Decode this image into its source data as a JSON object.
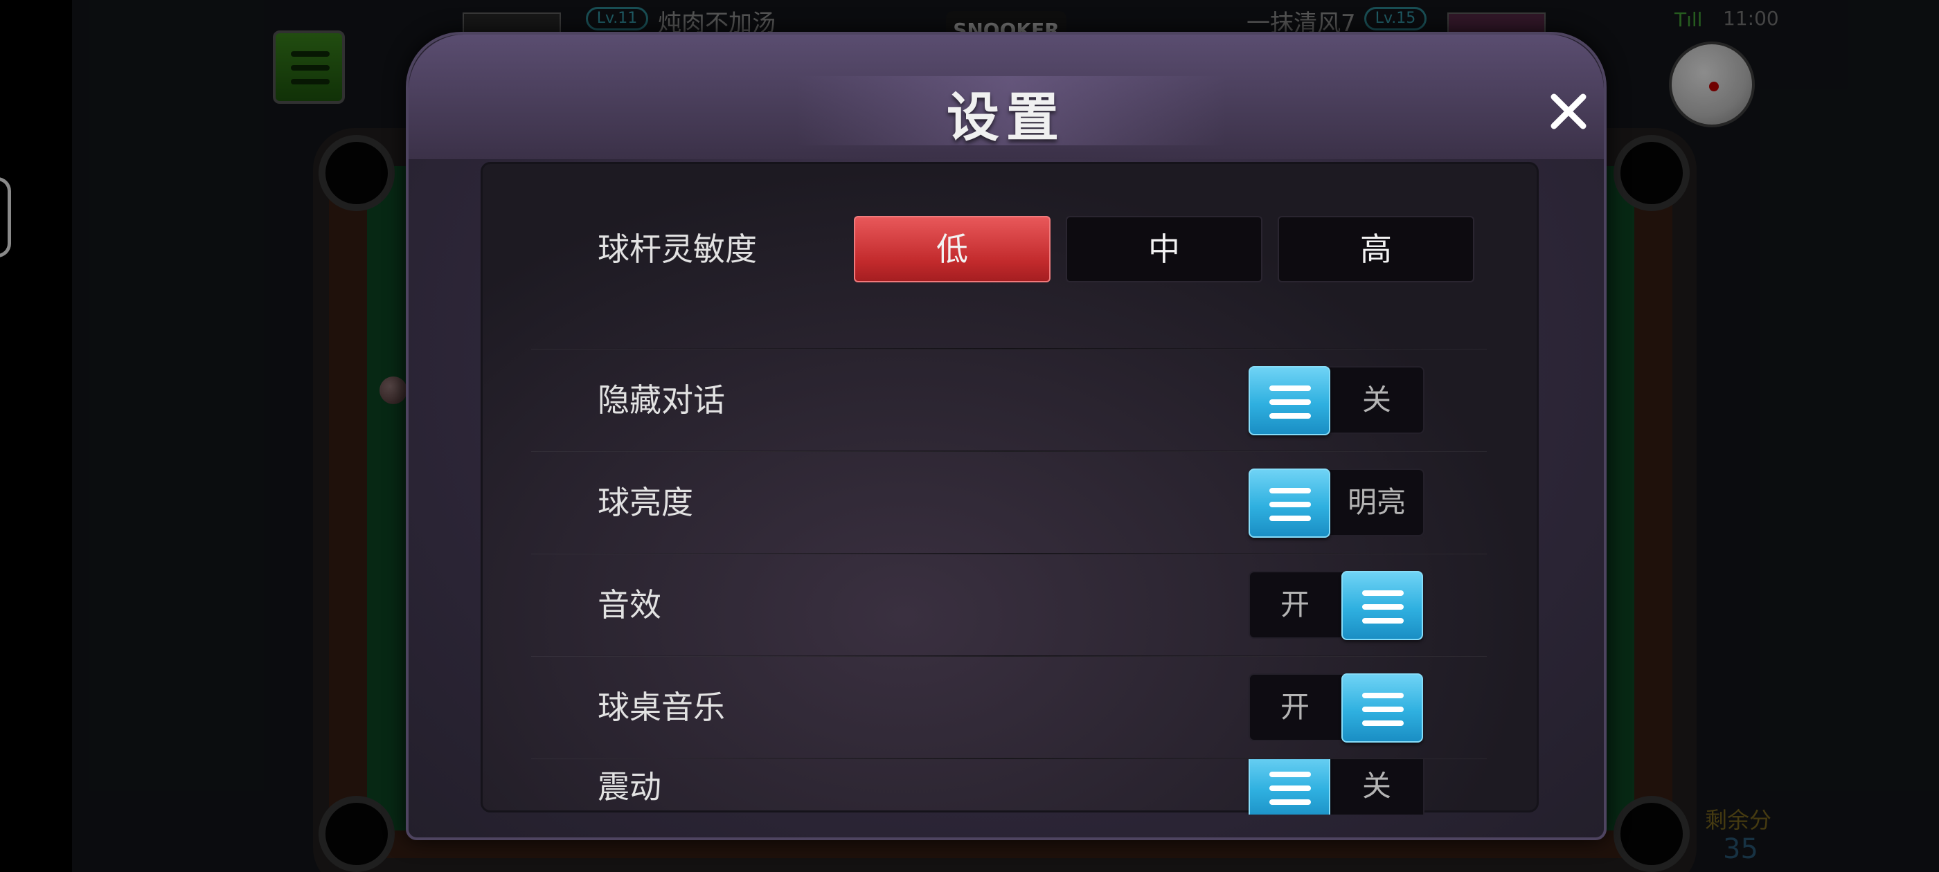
{
  "top_bar": {
    "left_player": {
      "level": "Lv.11",
      "name": "炖肉不加汤"
    },
    "right_player": {
      "level": "Lv.15",
      "name": "一抹清风7"
    },
    "mode": "SNOOKER",
    "time": "11:00",
    "signal": "Tıll"
  },
  "score": {
    "label": "剩余分",
    "value": "35"
  },
  "dialog": {
    "title": "设置",
    "close_icon": "close-icon",
    "rows": [
      {
        "label": "球杆灵敏度",
        "type": "segmented",
        "options": [
          "低",
          "中",
          "高"
        ],
        "selected": "低"
      },
      {
        "label": "隐藏对话",
        "type": "toggle",
        "on_text": "",
        "off_text": "关",
        "state": "off"
      },
      {
        "label": "球亮度",
        "type": "toggle",
        "on_text": "",
        "off_text": "明亮",
        "state": "off"
      },
      {
        "label": "音效",
        "type": "toggle",
        "on_text": "开",
        "off_text": "",
        "state": "on"
      },
      {
        "label": "球桌音乐",
        "type": "toggle",
        "on_text": "开",
        "off_text": "",
        "state": "on"
      },
      {
        "label": "震动",
        "type": "toggle",
        "on_text": "",
        "off_text": "关",
        "state": "off"
      }
    ]
  },
  "colors": {
    "accent_red": "#d9393b",
    "toggle_blue": "#2fb0e0",
    "felt_green": "#0e4a26"
  }
}
